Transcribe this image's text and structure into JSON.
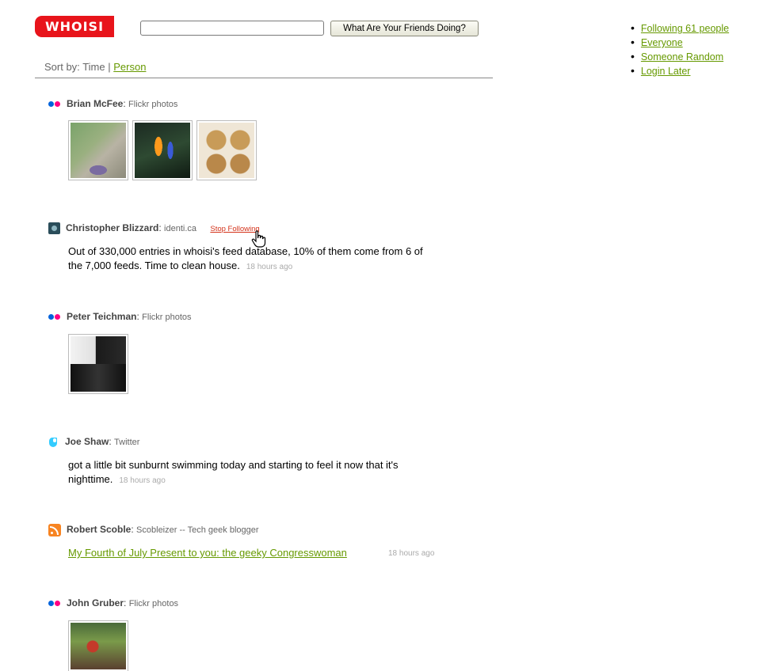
{
  "header": {
    "logo": "WHOISI",
    "search_value": "",
    "search_button": "What Are Your Friends Doing?"
  },
  "sort": {
    "label": "Sort by:",
    "time": "Time",
    "separator": "|",
    "person": "Person"
  },
  "side_nav": [
    "Following 61 people",
    "Everyone",
    "Someone Random",
    "Login Later"
  ],
  "entries": [
    {
      "name": "Brian McFee",
      "source": "Flickr photos",
      "icon": "flickr-icon"
    },
    {
      "name": "Christopher Blizzard",
      "source": "identi.ca",
      "icon": "identica-icon",
      "action": "Stop Following",
      "text": "Out of 330,000 entries in whoisi's feed database, 10% of them come from 6 of the 7,000 feeds. Time to clean house.",
      "time": "18 hours ago"
    },
    {
      "name": "Peter Teichman",
      "source": "Flickr photos",
      "icon": "flickr-icon"
    },
    {
      "name": "Joe Shaw",
      "source": "Twitter",
      "icon": "twitter-icon",
      "text": "got a little bit sunburnt swimming today and starting to feel it now that it's nighttime.",
      "time": "18 hours ago"
    },
    {
      "name": "Robert Scoble",
      "source": "Scobleizer -- Tech geek blogger",
      "icon": "rss-icon",
      "link": "My Fourth of July Present to you: the geeky Congresswoman",
      "time": "18 hours ago"
    },
    {
      "name": "John Gruber",
      "source": "Flickr photos",
      "icon": "flickr-icon"
    }
  ],
  "colors": {
    "brand": "#e8141b",
    "link": "#669900",
    "stop_following": "#d4331b"
  }
}
